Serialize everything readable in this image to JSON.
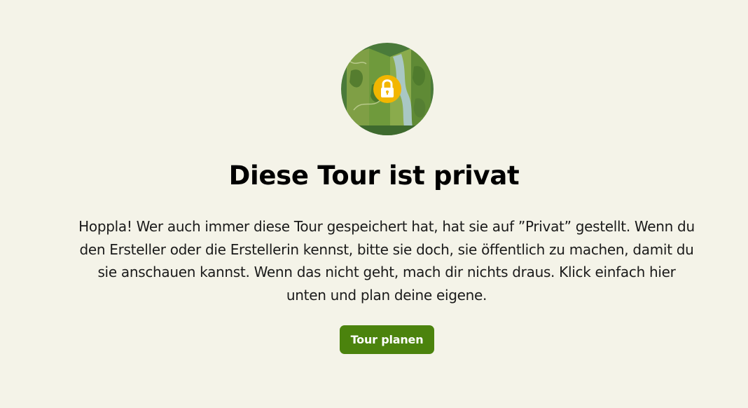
{
  "illustration": {
    "icon": "map-lock-icon",
    "colors": {
      "circle": "#4a7a3a",
      "map_light": "#8aaa4a",
      "map_dark": "#5e8a35",
      "river": "#9bbfbf",
      "lock_badge": "#f2b600"
    }
  },
  "title": "Diese Tour ist privat",
  "message": "Hoppla! Wer auch immer diese Tour gespeichert hat, hat sie auf ”Privat” gestellt. Wenn du den Ersteller oder die Erstellerin kennst, bitte sie doch, sie öffentlich zu machen, damit du sie anschauen kannst. Wenn das nicht geht, mach dir nichts draus. Klick einfach hier unten und plan deine eigene.",
  "cta": {
    "label": "Tour planen",
    "color": "#4b830d"
  },
  "background": "#f4f3e8"
}
